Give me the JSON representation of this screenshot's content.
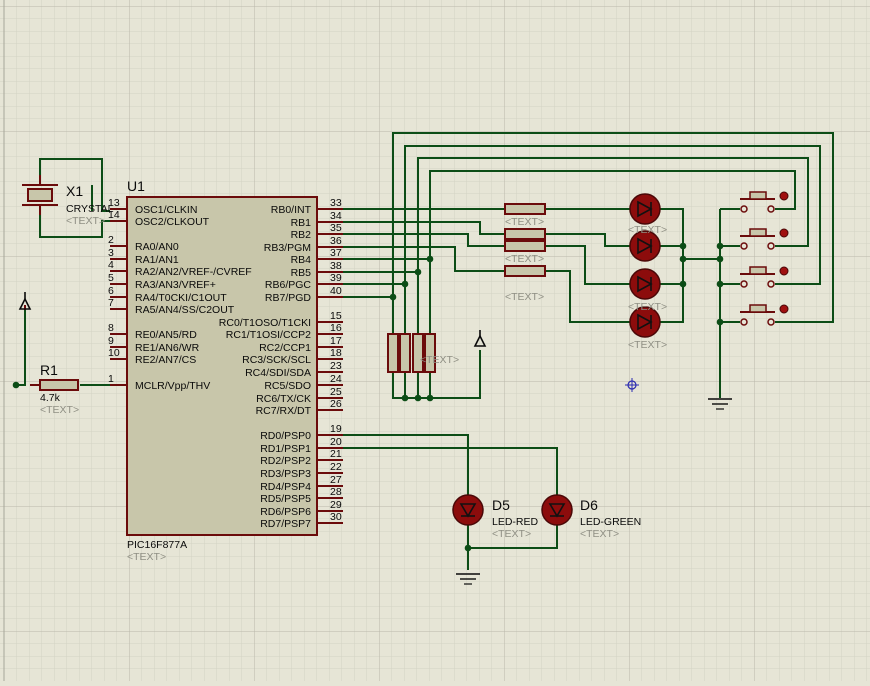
{
  "mcu": {
    "ref": "U1",
    "part": "PIC16F877A",
    "text": "<TEXT>",
    "left_pins": [
      {
        "num": "13",
        "name": "OSC1/CLKIN"
      },
      {
        "num": "14",
        "name": "OSC2/CLKOUT"
      },
      {
        "num": "2",
        "name": "RA0/AN0"
      },
      {
        "num": "3",
        "name": "RA1/AN1"
      },
      {
        "num": "4",
        "name": "RA2/AN2/VREF-/CVREF"
      },
      {
        "num": "5",
        "name": "RA3/AN3/VREF+"
      },
      {
        "num": "6",
        "name": "RA4/T0CKI/C1OUT"
      },
      {
        "num": "7",
        "name": "RA5/AN4/SS/C2OUT"
      },
      {
        "num": "8",
        "name": "RE0/AN5/RD"
      },
      {
        "num": "9",
        "name": "RE1/AN6/WR"
      },
      {
        "num": "10",
        "name": "RE2/AN7/CS"
      },
      {
        "num": "1",
        "name": "MCLR/Vpp/THV"
      }
    ],
    "right_pins": [
      {
        "num": "33",
        "name": "RB0/INT"
      },
      {
        "num": "34",
        "name": "RB1"
      },
      {
        "num": "35",
        "name": "RB2"
      },
      {
        "num": "36",
        "name": "RB3/PGM"
      },
      {
        "num": "37",
        "name": "RB4"
      },
      {
        "num": "38",
        "name": "RB5"
      },
      {
        "num": "39",
        "name": "RB6/PGC"
      },
      {
        "num": "40",
        "name": "RB7/PGD"
      },
      {
        "num": "15",
        "name": "RC0/T1OSO/T1CKI"
      },
      {
        "num": "16",
        "name": "RC1/T1OSI/CCP2"
      },
      {
        "num": "17",
        "name": "RC2/CCP1"
      },
      {
        "num": "18",
        "name": "RC3/SCK/SCL"
      },
      {
        "num": "23",
        "name": "RC4/SDI/SDA"
      },
      {
        "num": "24",
        "name": "RC5/SDO"
      },
      {
        "num": "25",
        "name": "RC6/TX/CK"
      },
      {
        "num": "26",
        "name": "RC7/RX/DT"
      },
      {
        "num": "19",
        "name": "RD0/PSP0"
      },
      {
        "num": "20",
        "name": "RD1/PSP1"
      },
      {
        "num": "21",
        "name": "RD2/PSP2"
      },
      {
        "num": "22",
        "name": "RD3/PSP3"
      },
      {
        "num": "27",
        "name": "RD4/PSP4"
      },
      {
        "num": "28",
        "name": "RD5/PSP5"
      },
      {
        "num": "29",
        "name": "RD6/PSP6"
      },
      {
        "num": "30",
        "name": "RD7/PSP7"
      }
    ]
  },
  "crystal": {
    "ref": "X1",
    "value": "CRYSTAL",
    "text": "<TEXT>"
  },
  "resistor_r1": {
    "ref": "R1",
    "value": "4.7k",
    "text": "<TEXT>"
  },
  "led_d5": {
    "ref": "D5",
    "value": "LED-RED",
    "text": "<TEXT>"
  },
  "led_d6": {
    "ref": "D6",
    "value": "LED-GREEN",
    "text": "<TEXT>"
  },
  "series_resistor_texts": [
    "<TEXT>",
    "<TEXT>",
    "<TEXT>"
  ],
  "led_array_texts": [
    "<TEXT>",
    "<TEXT>",
    "<TEXT>"
  ],
  "pullup_text": "<TEXT>",
  "colors": {
    "background": "#e6e5d6",
    "grid": "#cfcdbf",
    "wire": "#0c4d16",
    "component_outline": "#6b0b0b",
    "component_fill": "#c8c6aa",
    "led_fill": "#8c0c0c",
    "placeholder_text": "#8f8f84"
  }
}
